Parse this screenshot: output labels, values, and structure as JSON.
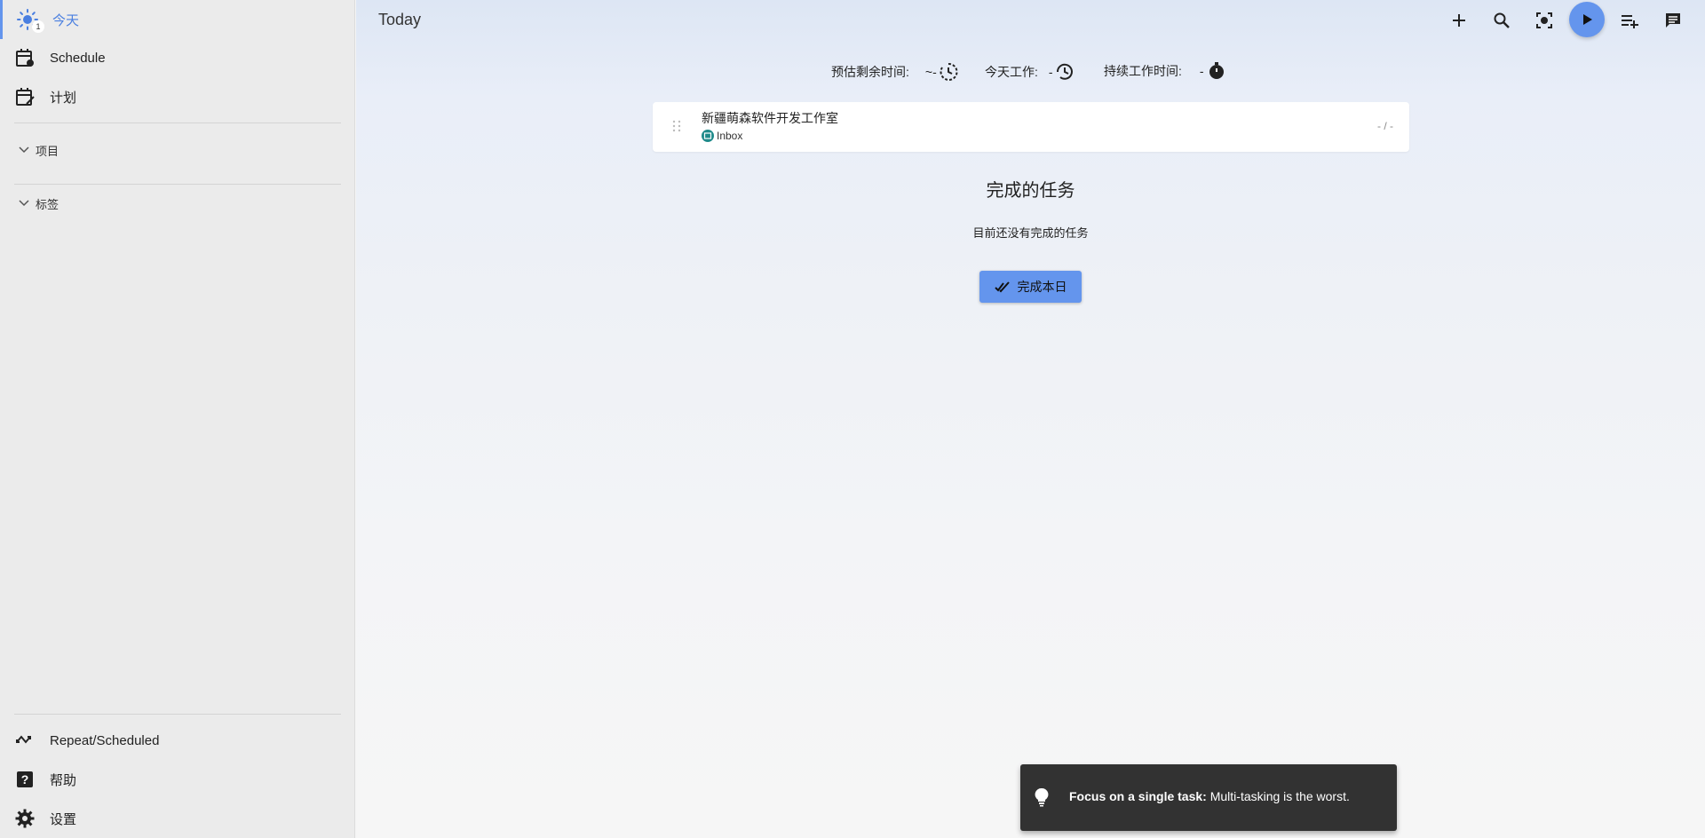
{
  "sidebar": {
    "items": [
      {
        "label": "今天",
        "icon": "sun-icon",
        "badge": "1",
        "active": true
      },
      {
        "label": "Schedule",
        "icon": "calendar-schedule-icon"
      },
      {
        "label": "计划",
        "icon": "calendar-edit-icon"
      }
    ],
    "sections": [
      {
        "label": "项目",
        "icon": "chevron-down-icon"
      },
      {
        "label": "标签",
        "icon": "chevron-down-icon"
      }
    ],
    "bottom_items": [
      {
        "label": "Repeat/Scheduled",
        "icon": "repeat-icon"
      },
      {
        "label": "帮助",
        "icon": "help-icon"
      },
      {
        "label": "设置",
        "icon": "gear-icon"
      }
    ],
    "accent_color": "#6495ed"
  },
  "header": {
    "title": "Today",
    "actions": [
      "add-icon",
      "search-icon",
      "focus-icon",
      "play-icon",
      "playlist-add-icon",
      "comment-icon"
    ]
  },
  "stats": {
    "estimate_label": "预估剩余时间:",
    "estimate_value": "~-",
    "worked_label": "今天工作:",
    "worked_value": "-",
    "session_label": "持续工作时间:",
    "session_value": "-"
  },
  "task": {
    "title": "新疆萌森软件开发工作室",
    "project": "Inbox",
    "time": "- / -"
  },
  "done": {
    "title": "完成的任务",
    "empty": "目前还没有完成的任务",
    "finish_button": "完成本日"
  },
  "snackbar": {
    "bold": "Focus on a single task:",
    "text": " Multi-tasking is the worst."
  }
}
